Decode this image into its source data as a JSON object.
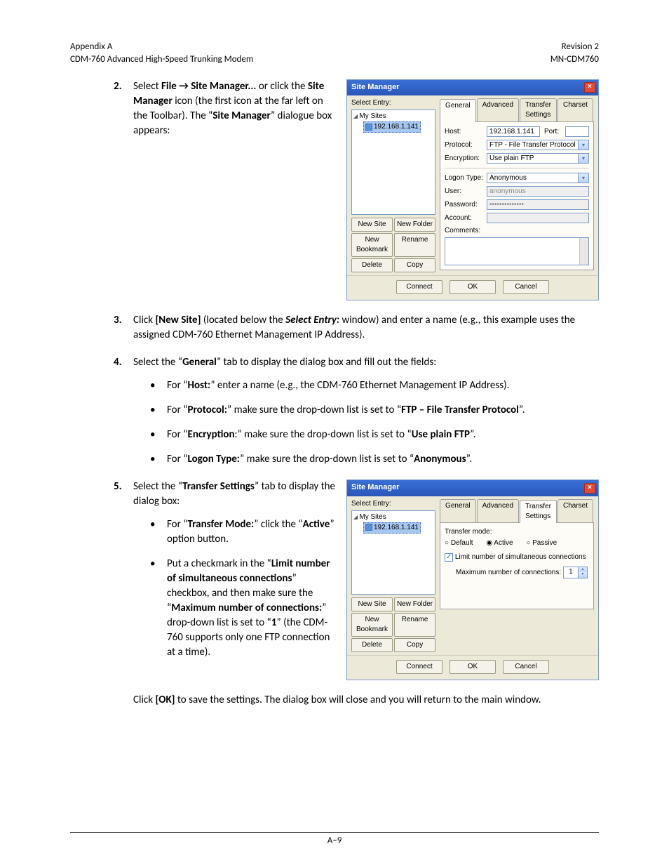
{
  "header": {
    "left": "Appendix A\nCDM-760 Advanced High-Speed Trunking Modem",
    "right": "Revision 2\nMN-CDM760"
  },
  "steps": {
    "s2": {
      "num": "2."
    },
    "s3": {
      "num": "3."
    },
    "s4": {
      "num": "4."
    },
    "s5": {
      "num": "5."
    }
  },
  "dialog1": {
    "title": "Site Manager",
    "select_entry": "Select Entry:",
    "root": "My Sites",
    "item": "192.168.1.141",
    "btns": {
      "new_site": "New Site",
      "new_folder": "New Folder",
      "new_bookmark": "New Bookmark",
      "rename": "Rename",
      "delete": "Delete",
      "copy": "Copy"
    },
    "tabs": {
      "general": "General",
      "advanced": "Advanced",
      "transfer": "Transfer Settings",
      "charset": "Charset"
    },
    "fields": {
      "host_l": "Host:",
      "host_v": "192.168.1.141",
      "port_l": "Port:",
      "proto_l": "Protocol:",
      "proto_v": "FTP - File Transfer Protocol",
      "enc_l": "Encryption:",
      "enc_v": "Use plain FTP",
      "logon_l": "Logon Type:",
      "logon_v": "Anonymous",
      "user_l": "User:",
      "user_v": "anonymous",
      "pass_l": "Password:",
      "pass_v": "••••••••••••••",
      "acct_l": "Account:",
      "comments_l": "Comments:"
    },
    "footer": {
      "connect": "Connect",
      "ok": "OK",
      "cancel": "Cancel"
    }
  },
  "dialog2": {
    "title": "Site Manager",
    "select_entry": "Select Entry:",
    "root": "My Sites",
    "item": "192.168.1.141",
    "tm_label": "Transfer mode:",
    "r_default": "Default",
    "r_active": "Active",
    "r_passive": "Passive",
    "chk_label": "Limit number of simultaneous connections",
    "max_label": "Maximum number of connections:",
    "max_val": "1"
  },
  "footer": {
    "page": "A–9"
  }
}
